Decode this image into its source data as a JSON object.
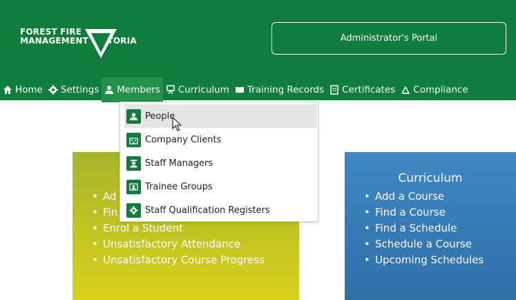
{
  "header": {
    "logo_line1": "FOREST FIRE",
    "logo_line2": "MANAGEMENT VICTORIA",
    "portal_label": "Administrator's Portal"
  },
  "nav": {
    "items": [
      {
        "label": "Home",
        "icon": "home-icon"
      },
      {
        "label": "Settings",
        "icon": "gear-icon"
      },
      {
        "label": "Members",
        "icon": "members-icon"
      },
      {
        "label": "Curriculum",
        "icon": "easel-icon"
      },
      {
        "label": "Training Records",
        "icon": "book-icon"
      },
      {
        "label": "Certificates",
        "icon": "certificate-icon"
      },
      {
        "label": "Compliance",
        "icon": "compliance-icon"
      }
    ]
  },
  "dropdown": {
    "items": [
      {
        "label": "People",
        "icon": "person-icon"
      },
      {
        "label": "Company Clients",
        "icon": "building-icon"
      },
      {
        "label": "Staff Managers",
        "icon": "manager-icon"
      },
      {
        "label": "Trainee Groups",
        "icon": "group-icon"
      },
      {
        "label": "Staff Qualification Registers",
        "icon": "gear-icon"
      }
    ]
  },
  "cards": {
    "students": {
      "visible_items": [
        "Ad",
        "Fin",
        "Enrol a Student",
        "Unsatisfactory Attendance",
        "Unsatisfactory Course Progress"
      ]
    },
    "curriculum": {
      "title": "Curriculum",
      "items": [
        "Add a Course",
        "Find a Course",
        "Find a Schedule",
        "Schedule a Course",
        "Upcoming Schedules"
      ]
    }
  },
  "colors": {
    "brand_green": "#0f7d3c",
    "active_green": "#23914c",
    "yellow_card": "#c9c623",
    "blue_card": "#3a7fbc"
  }
}
